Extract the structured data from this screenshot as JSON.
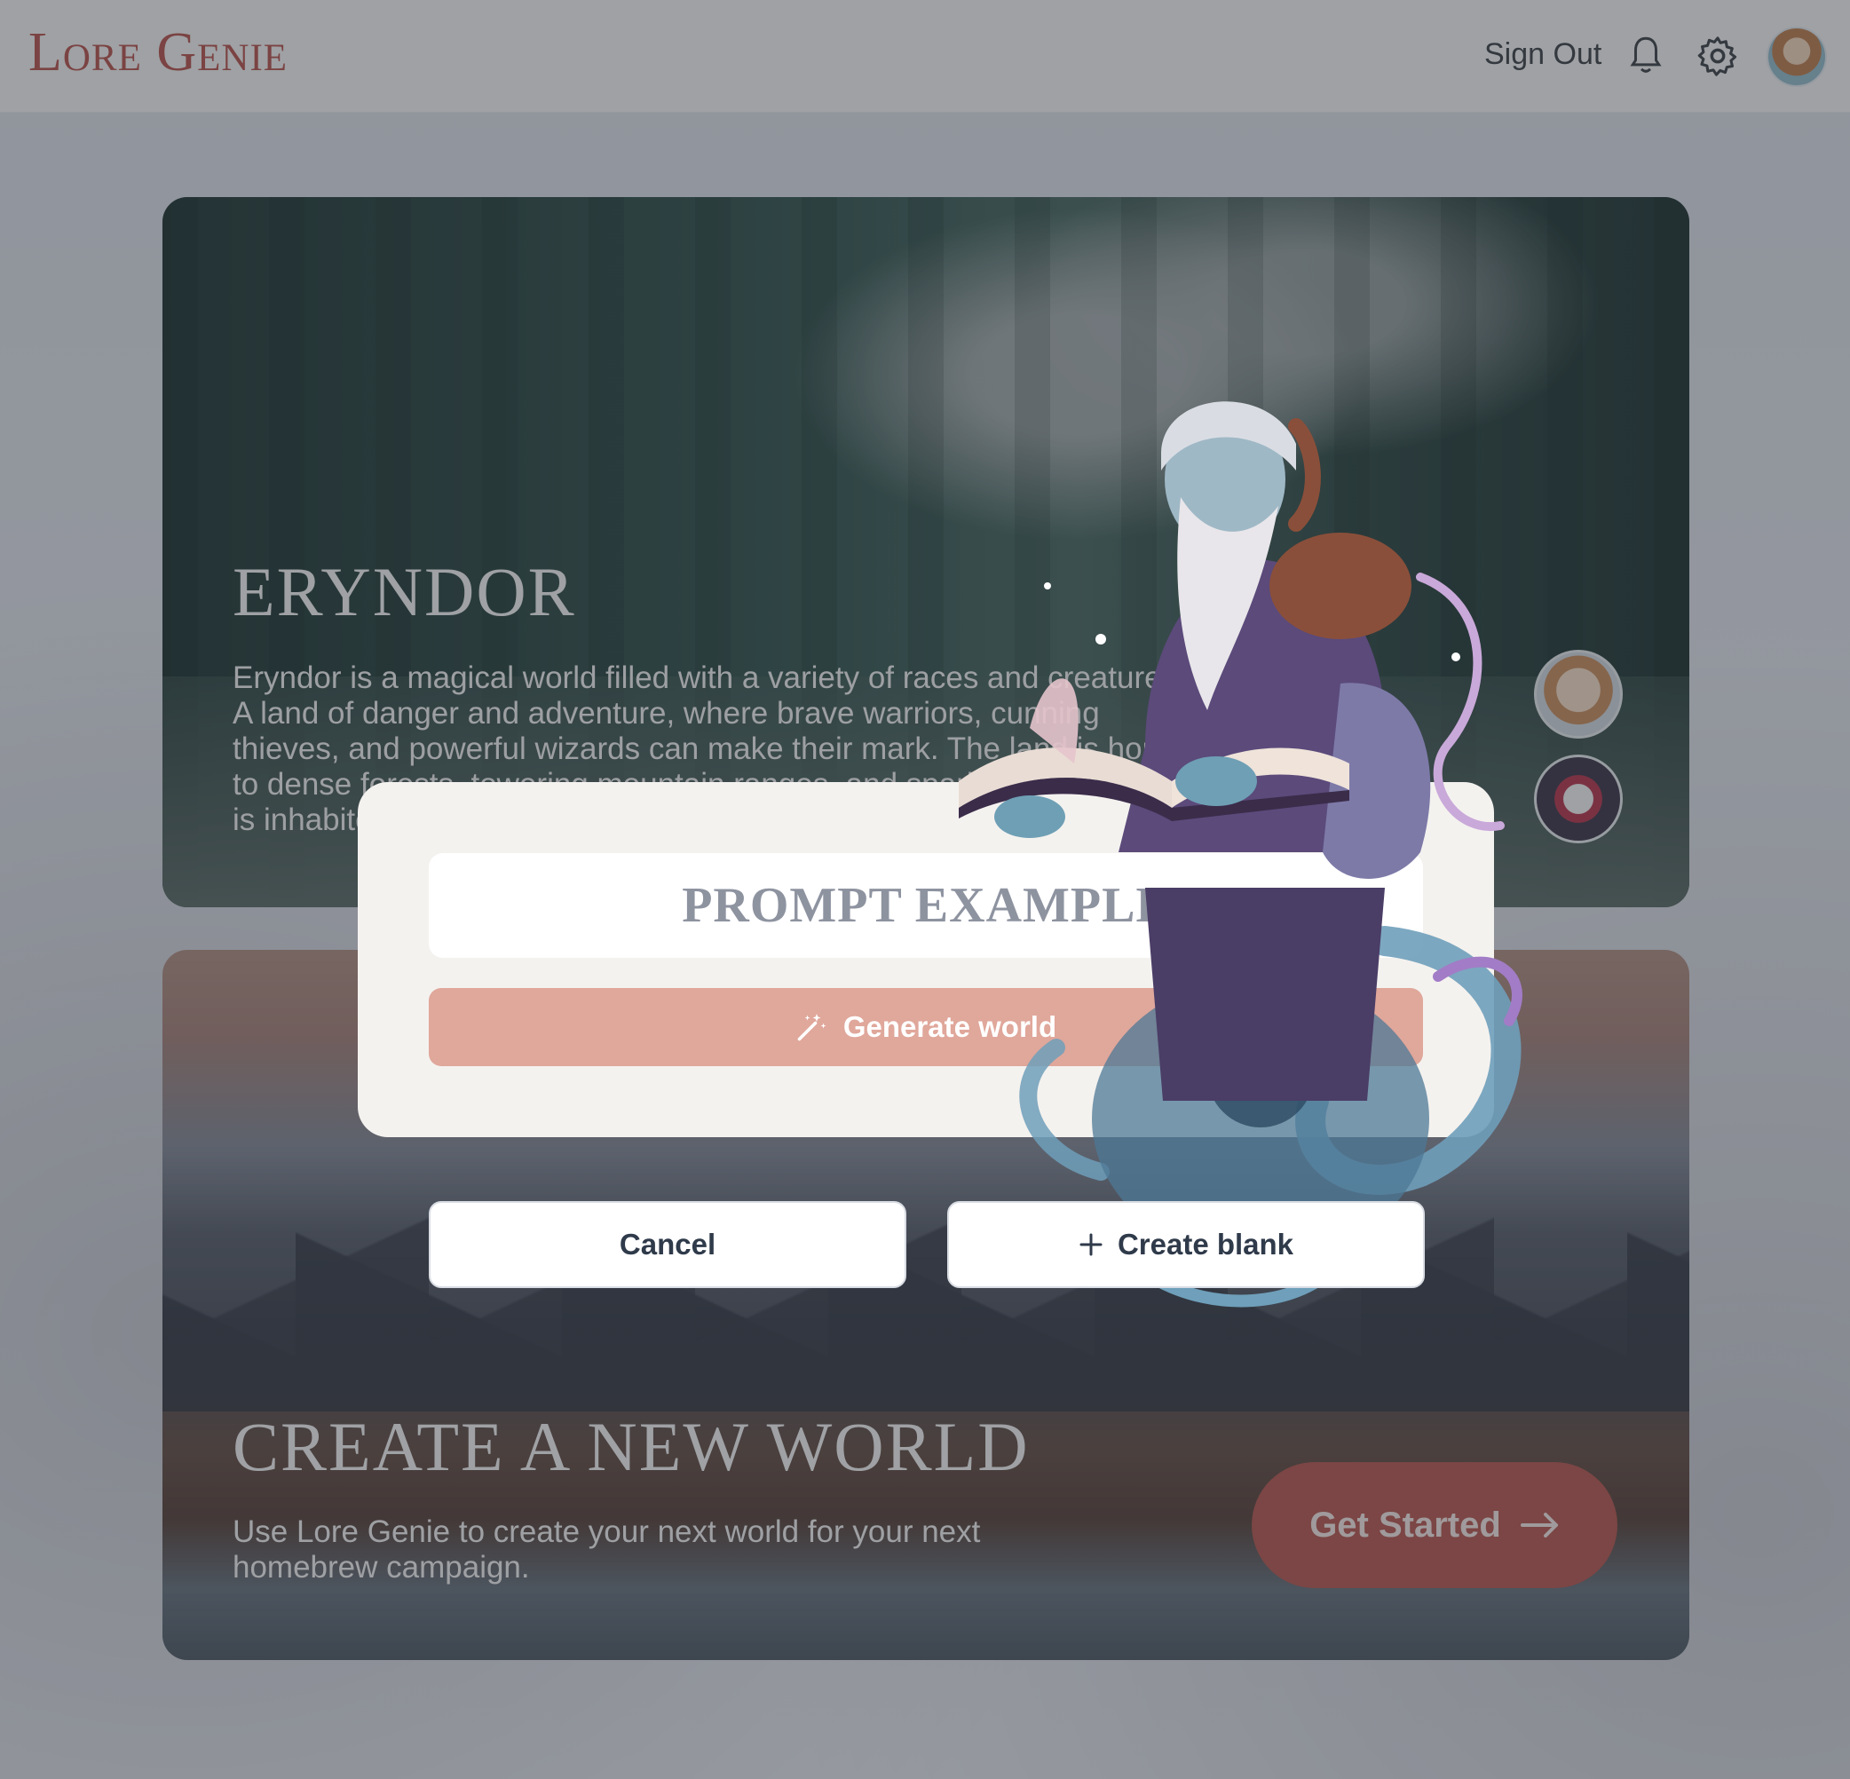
{
  "header": {
    "logo": "Lore Genie",
    "sign_out": "Sign Out",
    "icons": [
      "bell-icon",
      "gear-icon",
      "avatar"
    ]
  },
  "world_card": {
    "title": "ERYNDOR",
    "description": "Eryndor is a magical world filled with a variety of races and creatures. A land of danger and adventure, where brave warriors, cunning thieves, and powerful wizards can make their mark. The land is home to dense forests, towering mountain ranges, and sparkling seas, and is inhabited by elves, dwarves, orcs, and more."
  },
  "new_world_card": {
    "title": "CREATE A NEW WORLD",
    "description": "Use Lore Genie to create your next world for your next homebrew campaign.",
    "button_label": "Get Started"
  },
  "modal": {
    "prompt_placeholder": "PROMPT EXAMPLE",
    "generate_label": "Generate world",
    "cancel_label": "Cancel",
    "create_blank_label": "Create blank"
  },
  "colors": {
    "brand": "#b4504a",
    "generate": "#e0a79b",
    "get_started": "#b4554f"
  }
}
